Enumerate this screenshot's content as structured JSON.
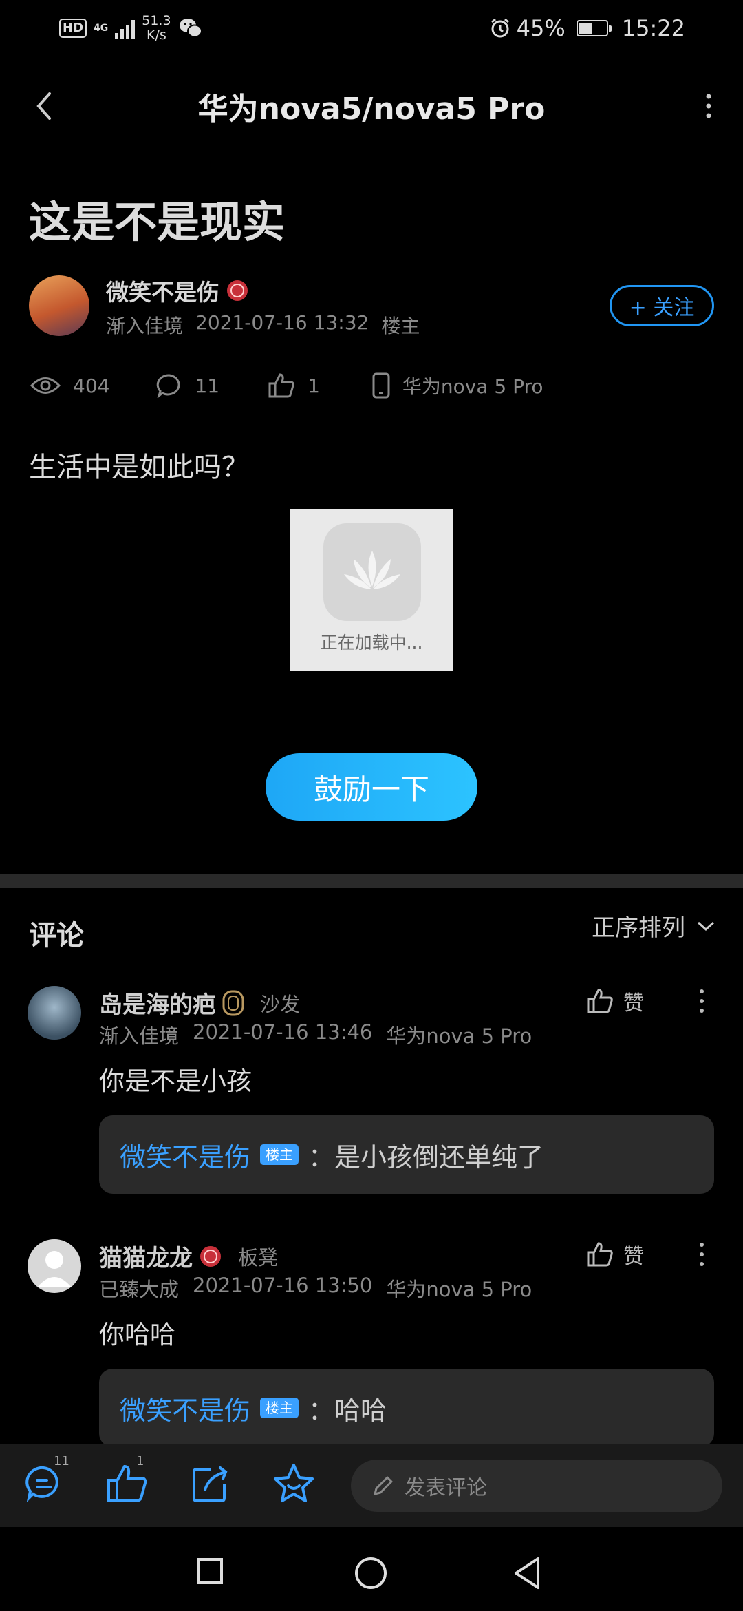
{
  "status": {
    "network_speed_value": "51.3",
    "network_speed_unit": "K/s",
    "battery": "45%",
    "time": "15:22",
    "signal_label": "4G"
  },
  "header": {
    "title": "华为nova5/nova5 Pro"
  },
  "post": {
    "title": "这是不是现实",
    "author": "微笑不是伤",
    "level": "渐入佳境",
    "datetime": "2021-07-16 13:32",
    "role": "楼主",
    "follow_label": "+ 关注",
    "views": "404",
    "comments": "11",
    "likes": "1",
    "device": "华为nova 5 Pro",
    "body": "生活中是如此吗？",
    "image_loading": "正在加载中...",
    "cheer_label": "鼓励一下"
  },
  "comments_section": {
    "title": "评论",
    "sort_label": "正序排列",
    "like_label": "赞",
    "items": [
      {
        "name": "岛是海的疤",
        "floor": "沙发",
        "level": "渐入佳境",
        "datetime": "2021-07-16 13:46",
        "device": "华为nova 5 Pro",
        "text": "你是不是小孩",
        "reply_name": "微笑不是伤",
        "reply_badge": "楼主",
        "reply_text": "：是小孩倒还单纯了"
      },
      {
        "name": "猫猫龙龙",
        "floor": "板凳",
        "level": "已臻大成",
        "datetime": "2021-07-16 13:50",
        "device": "华为nova 5 Pro",
        "text": "你哈哈",
        "reply_name": "微笑不是伤",
        "reply_badge": "楼主",
        "reply_text": "：哈哈"
      }
    ]
  },
  "bottom_bar": {
    "comment_count": "11",
    "like_count": "1",
    "input_placeholder": "发表评论"
  },
  "colors": {
    "accent": "#3aa0ff",
    "cheer_gradient_start": "#1ea7f6",
    "background": "#000000"
  }
}
